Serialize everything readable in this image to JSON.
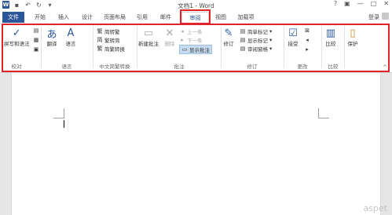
{
  "titlebar": {
    "title": "文档1 - Word",
    "qat": [
      "word-logo",
      "save-icon",
      "undo-icon",
      "redo-icon",
      "customize-icon"
    ],
    "logo_text": "W",
    "controls": [
      "?",
      "▣",
      "—",
      "□",
      "✕"
    ]
  },
  "tabs": {
    "file": "文件",
    "items": [
      "开始",
      "插入",
      "设计",
      "页面布局",
      "引用",
      "邮件",
      "审阅",
      "视图",
      "加载项"
    ],
    "active": "审阅",
    "login": "登录"
  },
  "ribbon": {
    "groups": {
      "proofing": {
        "label": "校对",
        "spell_label": "拼写和语法"
      },
      "language": {
        "label": "语言",
        "translate_label": "翻译",
        "language_label": "语言"
      },
      "chinese": {
        "label": "中文简繁转换",
        "to_trad": "简转繁",
        "to_simp": "繁转简",
        "convert": "简繁转换"
      },
      "comments": {
        "label": "批注",
        "new_comment": "新建批注",
        "delete": "删除",
        "prev": "上一条",
        "next": "下一条",
        "show": "显示批注"
      },
      "tracking": {
        "label": "修订",
        "track": "修订",
        "markup_mode": "简单标记",
        "show_markup": "显示标记",
        "review_pane": "审阅窗格"
      },
      "changes": {
        "label": "更改",
        "accept": "接受"
      },
      "compare": {
        "label": "比较",
        "compare_btn": "比较"
      },
      "protect": {
        "protect_btn": "保护"
      }
    },
    "collapse": "^"
  },
  "watermark": "aspet"
}
